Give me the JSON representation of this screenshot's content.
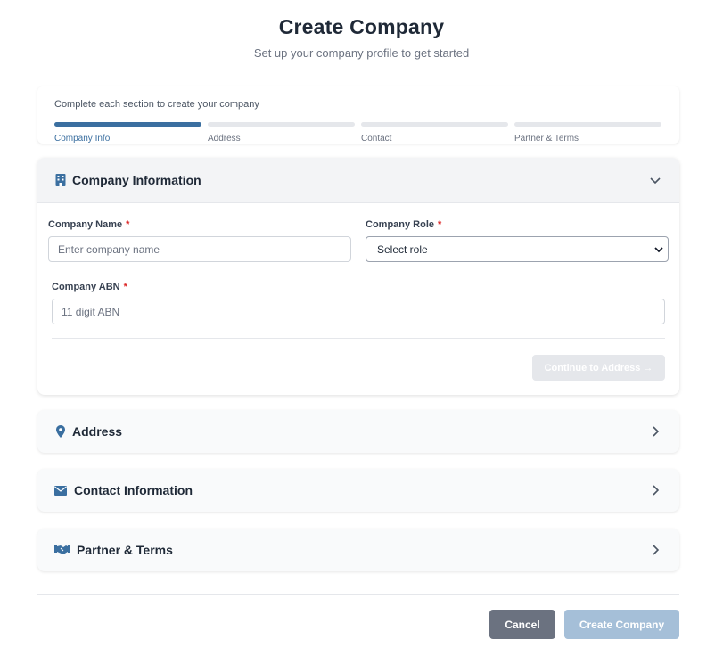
{
  "header": {
    "title": "Create Company",
    "subtitle": "Set up your company profile to get started"
  },
  "progress": {
    "caption": "Complete each section to create your company",
    "steps": [
      {
        "label": "Company Info",
        "active": true
      },
      {
        "label": "Address",
        "active": false
      },
      {
        "label": "Contact",
        "active": false
      },
      {
        "label": "Partner & Terms",
        "active": false
      }
    ]
  },
  "sections": {
    "company": {
      "title": "Company Information",
      "icon": "building-icon",
      "expanded": true,
      "fields": {
        "name": {
          "label": "Company Name",
          "required_mark": "*",
          "placeholder": "Enter company name",
          "value": ""
        },
        "role": {
          "label": "Company Role",
          "required_mark": "*",
          "selected": "Select role"
        },
        "abn": {
          "label": "Company ABN",
          "required_mark": "*",
          "placeholder": "11 digit ABN",
          "value": ""
        }
      },
      "continue_label": "Continue to Address →"
    },
    "address": {
      "title": "Address",
      "icon": "map-pin-icon"
    },
    "contact": {
      "title": "Contact Information",
      "icon": "envelope-icon"
    },
    "partner": {
      "title": "Partner & Terms",
      "icon": "handshake-icon"
    }
  },
  "footer": {
    "cancel_label": "Cancel",
    "create_label": "Create Company"
  },
  "colors": {
    "accent": "#3b6fa0",
    "required": "#dc2626",
    "cancel": "#6b7280",
    "create_disabled": "#a5bfd8"
  }
}
